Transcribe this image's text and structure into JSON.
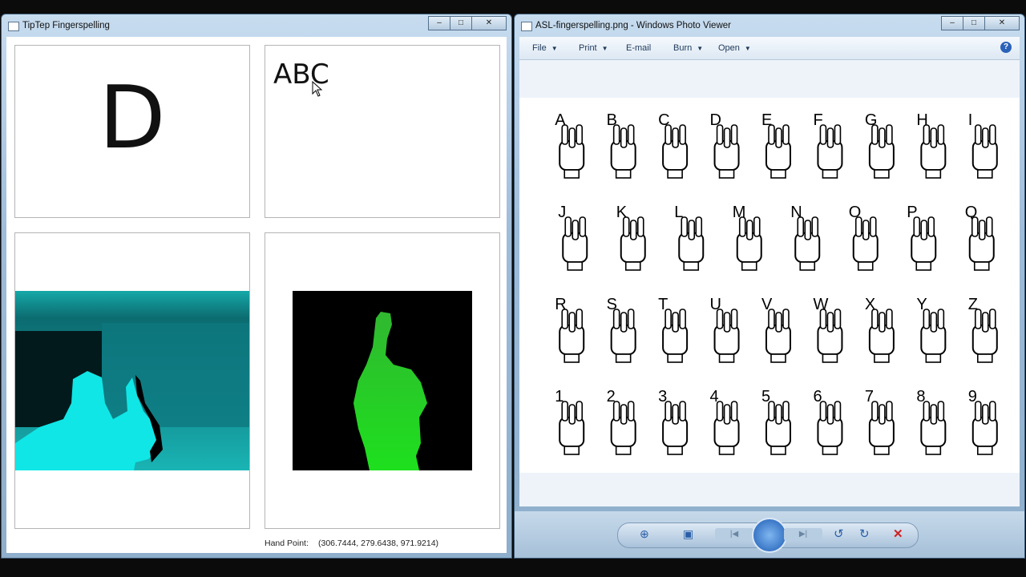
{
  "left_window": {
    "title": "TipTep Fingerspelling",
    "current_letter": "D",
    "spelled_text": "ABC",
    "hand_point_label": "Hand Point:",
    "hand_point_value": "(306.7444, 279.6438, 971.9214)"
  },
  "right_window": {
    "title": "ASL-fingerspelling.png - Windows Photo Viewer",
    "menu": {
      "file": "File",
      "print": "Print",
      "email": "E-mail",
      "burn": "Burn",
      "open": "Open"
    },
    "chart_labels": {
      "row1": [
        "A",
        "B",
        "C",
        "D",
        "E",
        "F",
        "G",
        "H",
        "I"
      ],
      "row2": [
        "J",
        "K",
        "L",
        "M",
        "N",
        "O",
        "P",
        "Q"
      ],
      "row3": [
        "R",
        "S",
        "T",
        "U",
        "V",
        "W",
        "X",
        "Y",
        "Z"
      ],
      "row4": [
        "1",
        "2",
        "3",
        "4",
        "5",
        "6",
        "7",
        "8",
        "9"
      ]
    }
  },
  "window_controls": {
    "minimize": "‒",
    "maximize": "□",
    "close": "✕"
  },
  "colors": {
    "depth_cyan": "#1ec8c8",
    "hand_green": "#22cc22",
    "accent": "#1e395b"
  }
}
